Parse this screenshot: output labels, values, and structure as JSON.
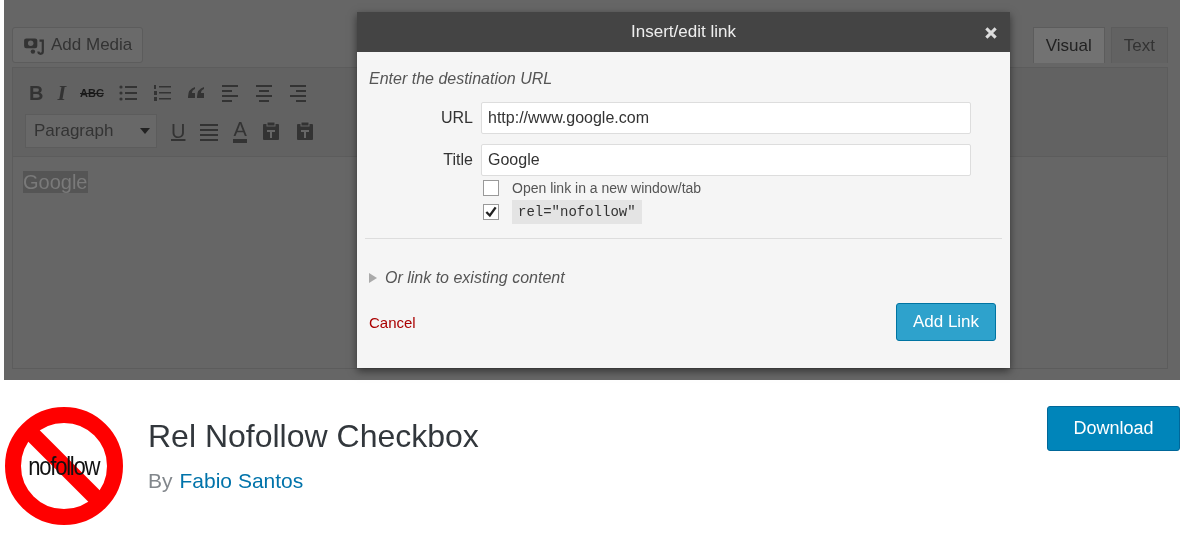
{
  "editor": {
    "add_media": "Add Media",
    "tabs": [
      {
        "label": "Visual",
        "selected": true
      },
      {
        "label": "Text",
        "selected": false
      }
    ],
    "toolbar_rows": [
      [
        {
          "kind": "bold",
          "label": "B"
        },
        {
          "kind": "italic",
          "label": "I"
        },
        {
          "kind": "strike",
          "label": "ABC"
        },
        {
          "kind": "bullets"
        },
        {
          "kind": "numbers"
        },
        {
          "kind": "quote"
        },
        {
          "kind": "align-left"
        },
        {
          "kind": "align-center"
        },
        {
          "kind": "align-right"
        }
      ],
      [
        {
          "kind": "select",
          "label": "Paragraph"
        },
        {
          "kind": "underline",
          "label": "U"
        },
        {
          "kind": "justify"
        },
        {
          "kind": "color",
          "label": "A"
        },
        {
          "kind": "paste-text"
        },
        {
          "kind": "paste-word"
        }
      ]
    ],
    "content": "Google"
  },
  "dialog": {
    "title": "Insert/edit link",
    "instruction": "Enter the destination URL",
    "fields": [
      {
        "label": "URL",
        "value": "http://www.google.com"
      },
      {
        "label": "Title",
        "value": "Google"
      }
    ],
    "options": [
      {
        "kind": "text",
        "label": "Open link in a new window/tab",
        "checked": false
      },
      {
        "kind": "code",
        "label": "rel=\"nofollow\"",
        "checked": true
      }
    ],
    "existing_link": {
      "label": "Or link to existing content",
      "expanded": false
    },
    "cancel": "Cancel",
    "submit": "Add Link"
  },
  "plugin": {
    "logo_text": "nofollow",
    "name": "Rel Nofollow Checkbox",
    "author_prefix": "By",
    "author": "Fabio Santos",
    "download": "Download"
  }
}
